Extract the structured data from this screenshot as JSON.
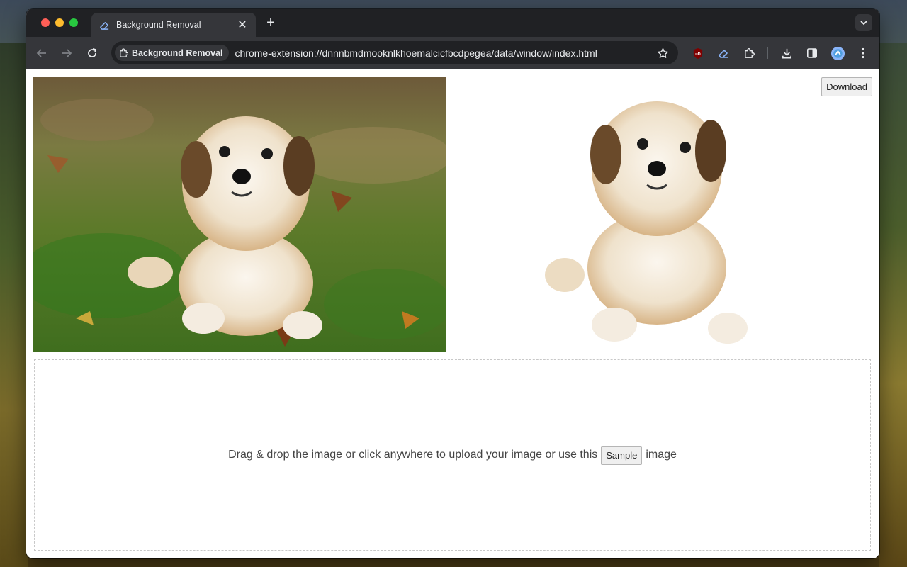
{
  "tab": {
    "title": "Background Removal"
  },
  "address_bar": {
    "chip_label": "Background Removal",
    "url": "chrome-extension://dnnnbmdmooknlkhoemalcicfbcdpegea/data/window/index.html"
  },
  "toolbar": {
    "extensions": [
      "ublock-origin-icon",
      "eraser-extension-icon",
      "puzzle-piece-icon"
    ],
    "download_icon": "download-icon",
    "side_panel_icon": "side-panel-icon",
    "profile_icon": "profile-avatar-icon",
    "menu_icon": "kebab-menu-icon"
  },
  "main": {
    "download_label": "Download",
    "drop_text_before": "Drag & drop the image or click anywhere to upload your image or use this",
    "sample_label": "Sample",
    "drop_text_after": "image"
  },
  "colors": {
    "browser_frame": "#202124",
    "toolbar": "#35363a",
    "accent_blue": "#8ab4f8"
  }
}
